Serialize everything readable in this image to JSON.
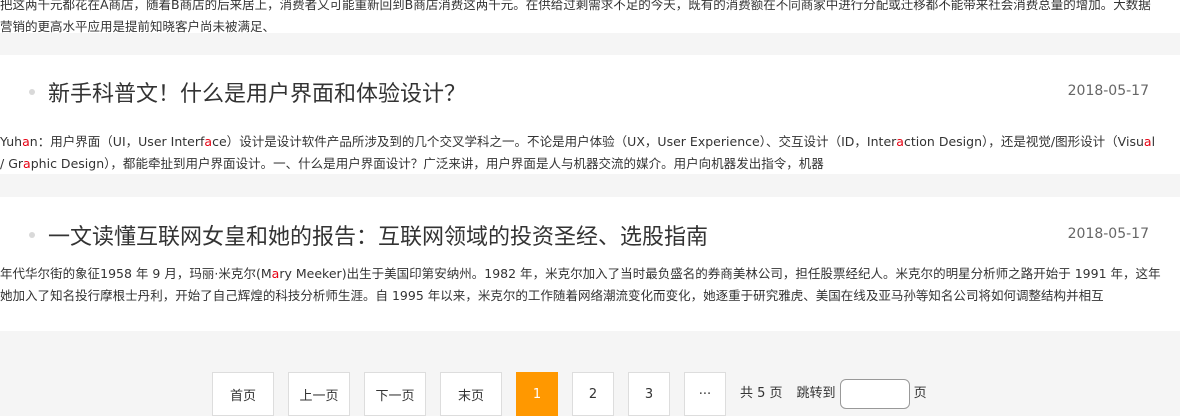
{
  "top_excerpt": "把这两千元都花在A商店，随着B商店的后来居上，消费者又可能重新回到B商店消费这两千元。在供给过剩需求不足的今天，既有的消费额在不同商家中进行分配或迁移都不能带来社会消费总量的增加。大数据营销的更高水平应用是提前知晓客户尚未被满足、",
  "articles": [
    {
      "title": "新手科普文！什么是用户界面和体验设计？",
      "date": "2018-05-17",
      "excerpt": "Yuhan：用户界面（UI，User Interface）设计是设计软件产品所涉及到的几个交叉学科之一。不论是用户体验（UX，User Experience）、交互设计（ID，Interaction Design），还是视觉/图形设计（Visual / Graphic Design），都能牵扯到用户界面设计。一、什么是用户界面设计？广泛来讲，用户界面是人与机器交流的媒介。用户向机器发出指令，机器"
    },
    {
      "title": "一文读懂互联网女皇和她的报告：互联网领域的投资圣经、选股指南",
      "date": "2018-05-17",
      "excerpt": "年代华尔街的象征1958 年 9 月，玛丽·米克尔(Mary Meeker)出生于美国印第安纳州。1982 年，米克尔加入了当时最负盛名的券商美林公司，担任股票经纪人。米克尔的明星分析师之路开始于 1991 年，这年她加入了知名投行摩根士丹利，开始了自己辉煌的科技分析师生涯。自 1995 年以来，米克尔的工作随着网络潮流变化而变化，她逐重于研究雅虎、美国在线及亚马孙等知名公司将如何调整结构并相互"
    }
  ],
  "pagination": {
    "first": "首页",
    "prev": "上一页",
    "next": "下一页",
    "last": "末页",
    "pages": [
      "1",
      "2",
      "3"
    ],
    "current": "1",
    "ellipsis": "···",
    "total": "共 5 页",
    "jump_label": "跳转到",
    "jump_suffix": "页",
    "jump_value": "",
    "active_color": "#ff9800"
  }
}
